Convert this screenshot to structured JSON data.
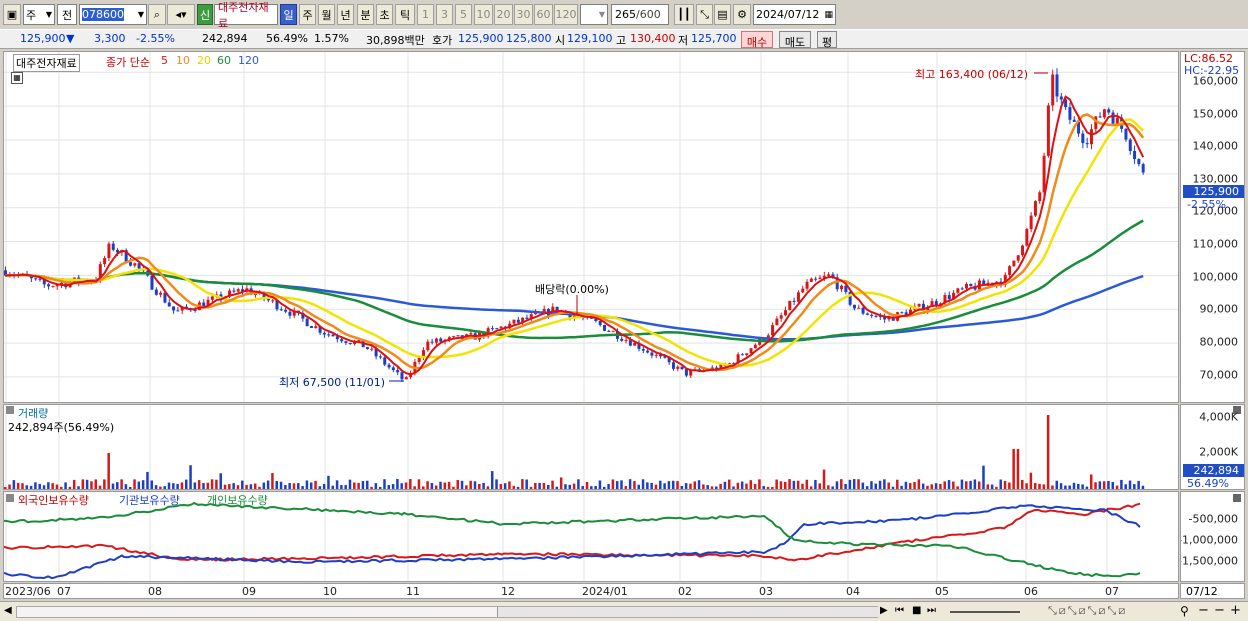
{
  "toolbar": {
    "type_main": "주",
    "type_sub": "전",
    "code": "078600",
    "credit_badge": "신",
    "stock_name": "대주전자재료",
    "period_buttons": [
      "일",
      "주",
      "월",
      "년",
      "분",
      "초",
      "틱"
    ],
    "tick_buttons": [
      "1",
      "3",
      "5",
      "10",
      "20",
      "30",
      "60",
      "120"
    ],
    "count": "265",
    "count_total": "/600",
    "date": "2024/07/12"
  },
  "quote": {
    "price": "125,900",
    "change": "3,300",
    "change_pct": "-2.55%",
    "volume": "242,894",
    "volume_ratio": "56.49%",
    "turnover_pct": "1.57%",
    "amount": "30,898백만",
    "bid_label": "호가",
    "bid1": "125,900",
    "bid2": "125,800",
    "open_label": "시",
    "open": "129,100",
    "high_label": "고",
    "high": "130,400",
    "low_label": "저",
    "low": "125,700",
    "buy_label": "매수",
    "sell_label": "매도",
    "eval_label": "평"
  },
  "price_panel": {
    "title": "대주전자재료",
    "ma_label": "종가 단순",
    "ma_periods": [
      "5",
      "10",
      "20",
      "60",
      "120"
    ],
    "lc_label": "LC:86.52",
    "hc_label": "HC:-22.95",
    "high_note": "최고 163,400 (06/12)",
    "low_note": "최저 67,500 (11/01)",
    "dividend_note": "배당락(0.00%)",
    "current_price": "125,900",
    "current_pct": "-2.55%",
    "y_ticks": [
      "160,000",
      "150,000",
      "140,000",
      "130,000",
      "120,000",
      "110,000",
      "100,000",
      "90,000",
      "80,000",
      "70,000"
    ]
  },
  "volume_panel": {
    "title": "거래량",
    "summary": "242,894주(56.49%)",
    "y_ticks": [
      "4,000K",
      "2,000K"
    ],
    "current": "242,894",
    "current_pct": "56.49%"
  },
  "holding_panel": {
    "foreign_label": "외국인보유수량",
    "inst_label": "기관보유수량",
    "indiv_label": "개인보유수량",
    "y_ticks": [
      "-500,000",
      "-1,000,000",
      "-1,500,000"
    ]
  },
  "x_axis": [
    "2023/06",
    "07",
    "08",
    "09",
    "10",
    "11",
    "12",
    "2024/01",
    "02",
    "03",
    "04",
    "05",
    "06",
    "07"
  ],
  "x_axis_end": "07/12",
  "colors": {
    "ma5": "#e01010",
    "ma10": "#f08a1a",
    "ma20": "#f2e400",
    "ma60": "#1a8c3a",
    "ma120": "#2a5ad8",
    "up": "#d81818",
    "down": "#1c3fc8"
  },
  "chart_data": {
    "type": "candlestick",
    "title": "대주전자재료",
    "x": [
      "2023/06",
      "07",
      "08",
      "09",
      "10",
      "11",
      "12",
      "2024/01",
      "02",
      "03",
      "04",
      "05",
      "06",
      "07"
    ],
    "monthly_close_approx": [
      101000,
      97000,
      90000,
      93000,
      78000,
      82000,
      86000,
      84000,
      72000,
      96000,
      88000,
      100000,
      145000,
      127000
    ],
    "high": {
      "value": 163400,
      "date": "06/12"
    },
    "low": {
      "value": 67500,
      "date": "11/01"
    },
    "last_close": 125900,
    "ylim": [
      62000,
      166000
    ]
  }
}
